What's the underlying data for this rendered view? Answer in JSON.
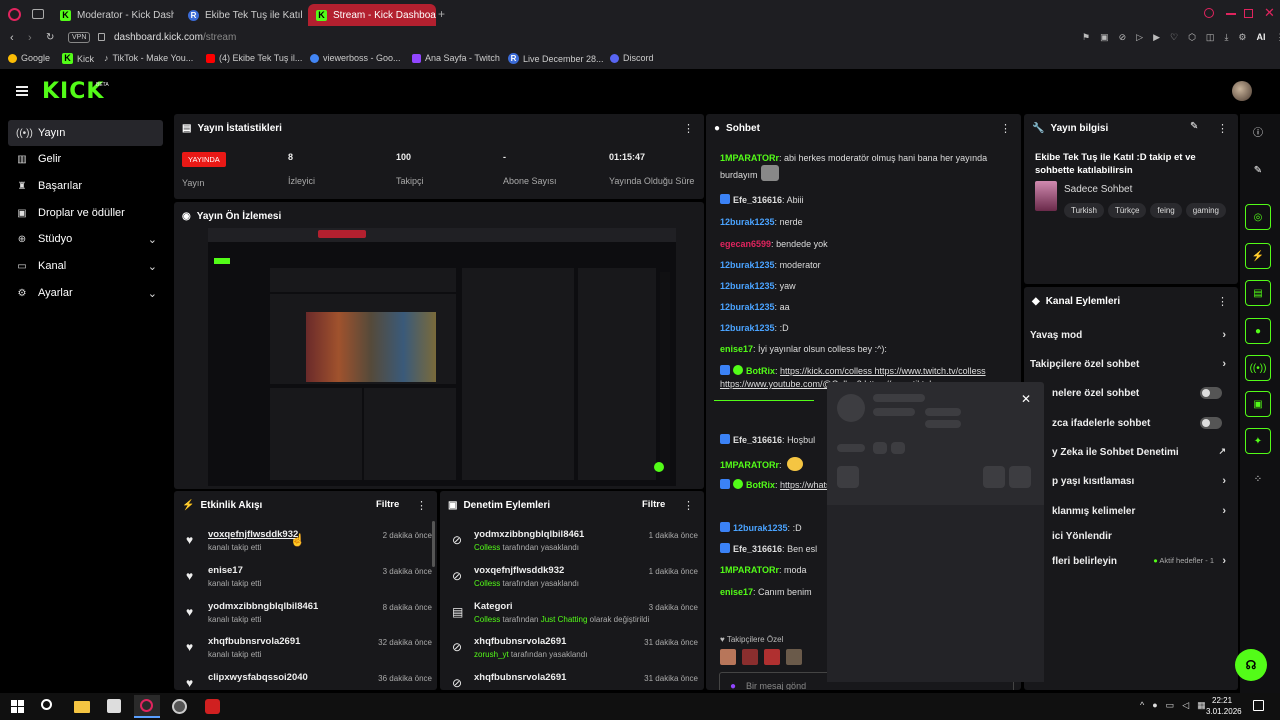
{
  "browser": {
    "tabs": [
      {
        "label": "Moderator - Kick Dashboa",
        "icon": "kick-favicon"
      },
      {
        "label": "Ekibe Tek Tuş ile Katıl :D t",
        "icon": "site-favicon"
      },
      {
        "label": "Stream - Kick Dashboard",
        "icon": "kick-favicon"
      }
    ],
    "url": "dashboard.kick.com/stream",
    "url_domain": "dashboard.kick.com",
    "url_path": "/stream",
    "vpn": "VPN",
    "ai_label": "AI",
    "bookmarks": [
      "Google",
      "Kick",
      "TikTok - Make You...",
      "(4) Ekibe Tek Tuş il...",
      "viewerboss - Goo...",
      "Ana Sayfa - Twitch",
      "Live December 28...",
      "Discord"
    ]
  },
  "logo": "KICK",
  "logo_beta": "BETA",
  "nav": [
    {
      "label": "Yayın",
      "icon": "broadcast-icon"
    },
    {
      "label": "Gelir",
      "icon": "revenue-icon"
    },
    {
      "label": "Başarılar",
      "icon": "trophy-icon"
    },
    {
      "label": "Droplar ve ödüller",
      "icon": "gift-icon"
    },
    {
      "label": "Stüdyo",
      "icon": "studio-icon"
    },
    {
      "label": "Kanal",
      "icon": "channel-icon"
    },
    {
      "label": "Ayarlar",
      "icon": "gear-icon"
    }
  ],
  "stats": {
    "title": "Yayın İstatistikleri",
    "live_badge": "YAYINDA",
    "live_label": "Yayın",
    "items": [
      {
        "value": "8",
        "label": "İzleyici"
      },
      {
        "value": "100",
        "label": "Takipçi"
      },
      {
        "value": "-",
        "label": "Abone Sayısı"
      },
      {
        "value": "01:15:47",
        "label": "Yayında Olduğu Süre"
      }
    ]
  },
  "preview": {
    "title": "Yayın Ön İzlemesi"
  },
  "activity": {
    "title": "Etkinlik Akışı",
    "filter": "Filtre",
    "items": [
      {
        "name": "voxqefnjflwsddk932",
        "sub": "kanalı takip etti",
        "time": "2 dakika önce"
      },
      {
        "name": "enise17",
        "sub": "kanalı takip etti",
        "time": "3 dakika önce"
      },
      {
        "name": "yodmxzibbngblqlbil8461",
        "sub": "kanalı takip etti",
        "time": "8 dakika önce"
      },
      {
        "name": "xhqfbubnsrvola2691",
        "sub": "kanalı takip etti",
        "time": "32 dakika önce"
      },
      {
        "name": "clipxwysfabqssoi2040",
        "sub": "",
        "time": "36 dakika önce"
      }
    ]
  },
  "moderation": {
    "title": "Denetim Eylemleri",
    "filter": "Filtre",
    "items": [
      {
        "name": "yodmxzibbngblqlbil8461",
        "actor": "Colless",
        "action": "tarafından yasaklandı",
        "time": "1 dakika önce",
        "icon": "ban-icon"
      },
      {
        "name": "voxqefnjflwsddk932",
        "actor": "Colless",
        "action": "tarafından yasaklandı",
        "time": "1 dakika önce",
        "icon": "ban-icon"
      },
      {
        "name": "Kategori",
        "actor": "Colless",
        "action": "tarafından",
        "extra": "Just Chatting",
        "action2": "olarak değiştirildi",
        "time": "3 dakika önce",
        "icon": "category-icon"
      },
      {
        "name": "xhqfbubnsrvola2691",
        "actor": "zorush_yt",
        "action": "tarafından yasaklandı",
        "time": "31 dakika önce",
        "icon": "ban-icon"
      },
      {
        "name": "xhqfbubnsrvola2691",
        "actor": "",
        "action": "",
        "time": "31 dakika önce",
        "icon": "ban-icon"
      }
    ]
  },
  "chat": {
    "title": "Sohbet",
    "messages": [
      {
        "user": "1MPARATORr",
        "text": "abi herkes moderatör olmuş hani bana her yayında burdayım",
        "color": "#53fc18"
      },
      {
        "user": "Efe_316616",
        "text": "Abiii",
        "color": "#dddddd"
      },
      {
        "user": "12burak1235",
        "text": "nerde",
        "color": "#4aa3ff"
      },
      {
        "user": "egecan6599",
        "text": "bendede yok",
        "color": "#e0245e"
      },
      {
        "user": "12burak1235",
        "text": "moderator",
        "color": "#4aa3ff"
      },
      {
        "user": "12burak1235",
        "text": "yaw",
        "color": "#4aa3ff"
      },
      {
        "user": "12burak1235",
        "text": "aa",
        "color": "#4aa3ff"
      },
      {
        "user": "12burak1235",
        "text": ":D",
        "color": "#4aa3ff"
      },
      {
        "user": "enise17",
        "text": "İyi yayınlar olsun colless bey :^):",
        "color": "#53fc18"
      },
      {
        "user": "BotRix",
        "text": "https://kick.com/colless https://www.twitch.tv/colless https://www.youtube.com/@Colles2 https://www.tiktok.com",
        "color": "#53fc18"
      },
      {
        "user": "Efe_316616",
        "text": "Hoşbul",
        "color": "#dddddd"
      },
      {
        "user": "1MPARATORr",
        "text": "",
        "color": "#53fc18"
      },
      {
        "user": "BotRix",
        "text": "https://whatsapp.com/c Whatsapp Kanalımız...",
        "color": "#53fc18"
      },
      {
        "user": "12burak1235",
        "text": ":D",
        "color": "#4aa3ff"
      },
      {
        "user": "Efe_316616",
        "text": "Ben esl",
        "color": "#dddddd"
      },
      {
        "user": "1MPARATORr",
        "text": "moda",
        "color": "#53fc18"
      },
      {
        "user": "enise17",
        "text": "Canım benim",
        "color": "#53fc18"
      }
    ],
    "follower_only": "Takipçilere Özel",
    "input_placeholder": "Bir mesaj gönd"
  },
  "info": {
    "title": "Yayın bilgisi",
    "stream_title": "Ekibe Tek Tuş ile Katıl :D takip et ve sohbette katılabilirsin",
    "category": "Sadece Sohbet",
    "tags": [
      "Turkish",
      "Türkçe",
      "feing",
      "gaming"
    ]
  },
  "channel_actions": {
    "title": "Kanal Eylemleri",
    "rows": [
      {
        "label": "Yavaş mod",
        "control": "chevron"
      },
      {
        "label": "Takipçilere özel sohbet",
        "control": "chevron"
      },
      {
        "label": "nelere özel sohbet",
        "control": "toggle"
      },
      {
        "label": "zca ifadelerle sohbet",
        "control": "toggle"
      },
      {
        "label": "y Zeka ile Sohbet Denetimi",
        "control": "external"
      },
      {
        "label": "p yaşı kısıtlaması",
        "control": "chevron"
      },
      {
        "label": "klanmış kelimeler",
        "control": "chevron"
      },
      {
        "label": "ici Yönlendir",
        "control": "none"
      },
      {
        "label": "fleri belirleyin",
        "control": "chevron",
        "badge": "Aktif hedefler - 1"
      }
    ]
  },
  "taskbar": {
    "time": "22:21",
    "date": "3.01.2026"
  },
  "colors": {
    "accent": "#53fc18",
    "panel": "#18181b",
    "live": "#e91916"
  }
}
